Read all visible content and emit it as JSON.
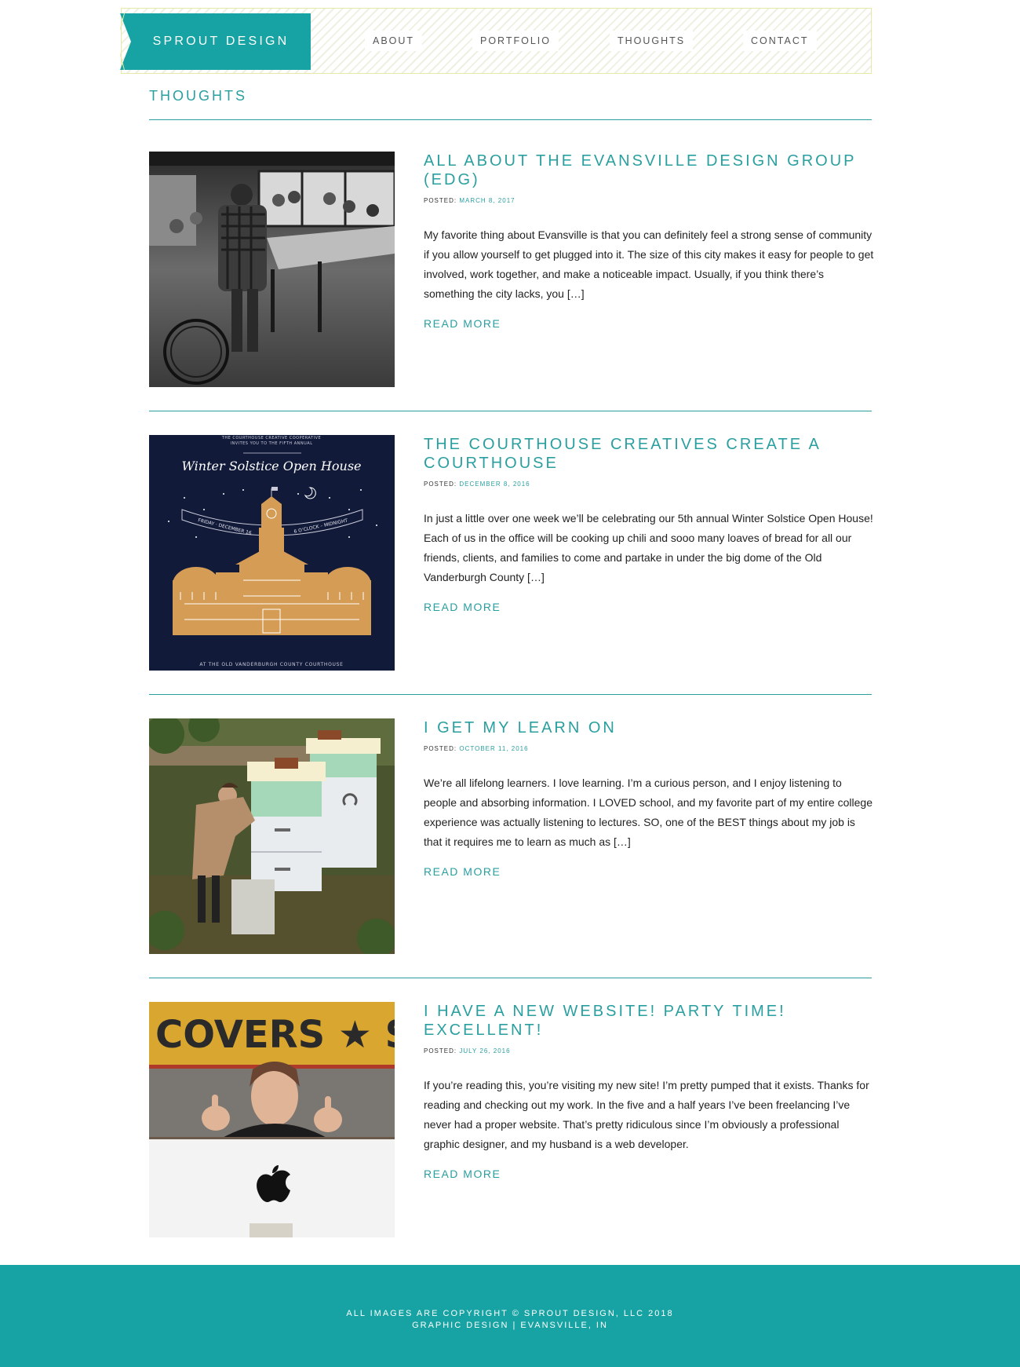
{
  "brand": {
    "logo_text": "SPROUT DESIGN",
    "accent": "#17a3a3",
    "text_color": "#2a9fa0"
  },
  "nav": {
    "items": [
      {
        "label": "ABOUT"
      },
      {
        "label": "PORTFOLIO"
      },
      {
        "label": "THOUGHTS"
      },
      {
        "label": "CONTACT"
      }
    ]
  },
  "page": {
    "title": "THOUGHTS"
  },
  "posts": [
    {
      "title": "ALL ABOUT THE EVANSVILLE DESIGN GROUP (EDG)",
      "posted_label": "POSTED:",
      "date": "MARCH 8, 2017",
      "excerpt": "My favorite thing about Evansville is that you can definitely feel a strong sense of community if you allow yourself to get plugged into it. The size of this city makes it easy for people to get involved, work together, and make a noticeable impact. Usually, if you think there’s something the city lacks, you […]",
      "read_more": "READ MORE",
      "image": "black-and-white photo of a group meeting in a cafe"
    },
    {
      "title": "THE COURTHOUSE CREATIVES CREATE A COURTHOUSE",
      "posted_label": "POSTED:",
      "date": "DECEMBER 8, 2016",
      "excerpt": "In just a little over one week we’ll be celebrating our 5th annual Winter Solstice Open House! Each of us in the office will be cooking up chili and sooo many loaves of bread for all our friends, clients, and families to come and partake in under the big dome of the Old Vanderburgh County […]",
      "read_more": "READ MORE",
      "poster": {
        "top_line_1": "THE COURTHOUSE CREATIVE COOPERATIVE",
        "top_line_2": "INVITES YOU TO THE FIFTH ANNUAL",
        "headline": "Winter Solstice Open House",
        "banner_left": "FRIDAY · DECEMBER 16",
        "banner_right": "6 O’CLOCK – MIDNIGHT",
        "bottom_line": "AT THE OLD VANDERBURGH COUNTY COURTHOUSE"
      }
    },
    {
      "title": "I GET MY LEARN ON",
      "posted_label": "POSTED:",
      "date": "OCTOBER 11, 2016",
      "excerpt": "We’re all lifelong learners. I love learning. I’m a curious person, and I enjoy listening to people and absorbing information. I LOVED school, and my favorite part of my entire college experience was actually listening to lectures. SO, one of the BEST things about my job is that it requires me to learn as much as […]",
      "read_more": "READ MORE",
      "image": "woman peering into white and green beehives in a garden"
    },
    {
      "title": "I HAVE A NEW WEBSITE! PARTY TIME! EXCELLENT!",
      "posted_label": "POSTED:",
      "date": "JULY 26, 2016",
      "excerpt": "If you’re reading this, you’re visiting my new site! I’m pretty pumped that it exists. Thanks for reading and checking out my work. In the five and a half years I’ve been freelancing I’ve never had a proper website. That’s pretty ridiculous since I’m obviously a professional graphic designer, and my husband is a web developer.",
      "read_more": "READ MORE",
      "image": "woman giving two thumbs up behind a computer monitor",
      "sign_text": "COVERS ★ SP"
    }
  ],
  "footer": {
    "line1": "ALL IMAGES ARE COPYRIGHT © SPROUT DESIGN, LLC 2018",
    "line2": "GRAPHIC DESIGN | EVANSVILLE, IN"
  }
}
